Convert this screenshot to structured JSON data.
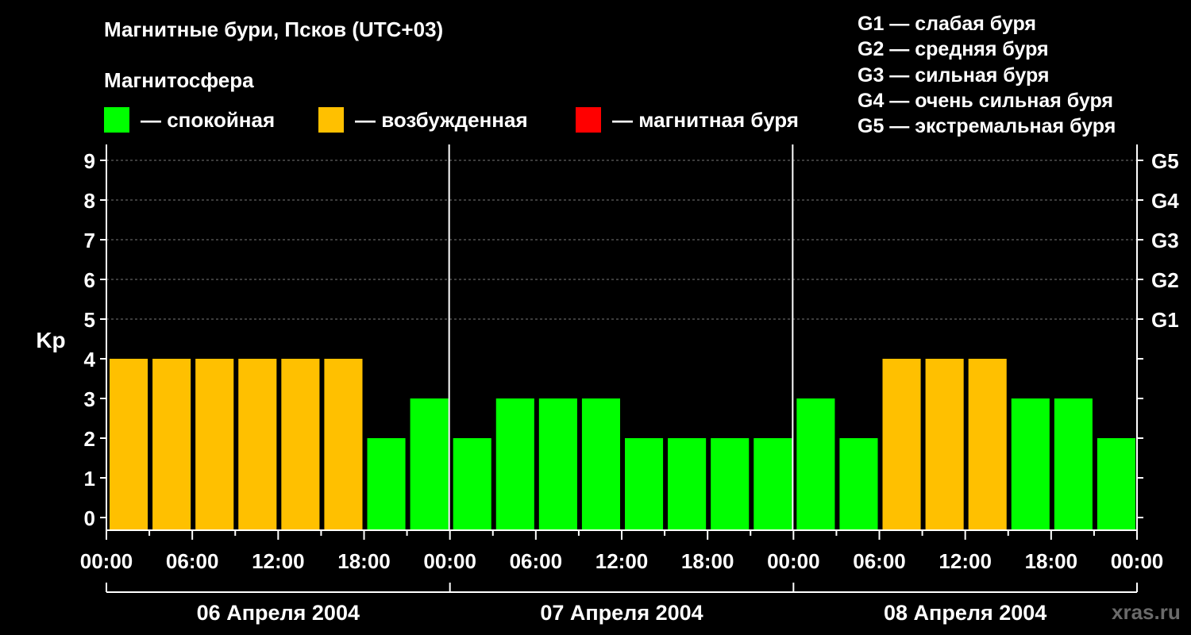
{
  "header": {
    "title": "Магнитные бури, Псков (UTC+03)",
    "subtitle": "Магнитосфера"
  },
  "legend": {
    "items": [
      {
        "label": "— спокойная",
        "color": "#00ff00"
      },
      {
        "label": "— возбужденная",
        "color": "#ffc000"
      },
      {
        "label": "— магнитная буря",
        "color": "#ff0000"
      }
    ]
  },
  "g_legend": [
    "G1 — слабая буря",
    "G2 — средняя буря",
    "G3 — сильная буря",
    "G4 — очень сильная буря",
    "G5 — экстремальная буря"
  ],
  "watermark": "xras.ru",
  "chart_data": {
    "type": "bar",
    "title": "Магнитные бури, Псков (UTC+03)",
    "ylabel": "Kp",
    "ylim": [
      0,
      9
    ],
    "yticks": [
      0,
      1,
      2,
      3,
      4,
      5,
      6,
      7,
      8,
      9
    ],
    "right_ticks": [
      {
        "kp": 5,
        "label": "G1"
      },
      {
        "kp": 6,
        "label": "G2"
      },
      {
        "kp": 7,
        "label": "G3"
      },
      {
        "kp": 8,
        "label": "G4"
      },
      {
        "kp": 9,
        "label": "G5"
      }
    ],
    "grid": "dashed horizontal at Kp 5–9",
    "interval_hours": 3,
    "days": [
      "06 Апреля 2004",
      "07 Апреля 2004",
      "08 Апреля 2004"
    ],
    "x_tick_labels": [
      "00:00",
      "06:00",
      "12:00",
      "18:00",
      "00:00",
      "06:00",
      "12:00",
      "18:00",
      "00:00",
      "06:00",
      "12:00",
      "18:00",
      "00:00"
    ],
    "values": [
      4,
      4,
      4,
      4,
      4,
      4,
      2,
      3,
      2,
      3,
      3,
      3,
      2,
      2,
      2,
      2,
      3,
      2,
      4,
      4,
      4,
      3,
      3,
      2
    ],
    "colors": {
      "calm": "#00ff00",
      "active": "#ffc000",
      "storm": "#ff0000"
    }
  }
}
